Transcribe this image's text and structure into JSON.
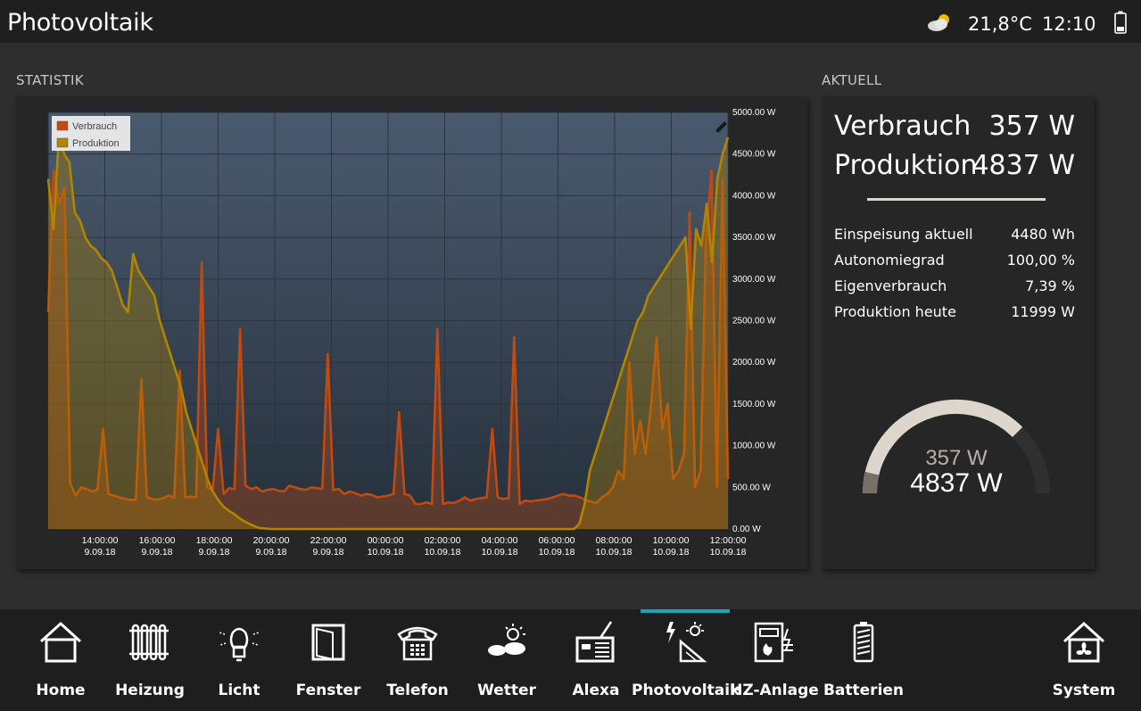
{
  "header": {
    "title": "Photovoltaik",
    "weather_icon": "partly-cloudy-icon",
    "temperature": "21,8°C",
    "time": "12:10",
    "battery_icon": "battery-icon"
  },
  "statistik": {
    "section_title": "STATISTIK",
    "chart_data": {
      "type": "line",
      "title": "",
      "series": [
        {
          "name": "Verbrauch",
          "color": "#c04a10",
          "values": [
            2600,
            4300,
            3900,
            4100,
            550,
            400,
            500,
            480,
            450,
            470,
            1200,
            420,
            400,
            380,
            360,
            350,
            350,
            1800,
            380,
            360,
            350,
            370,
            400,
            380,
            1900,
            380,
            390,
            380,
            3200,
            500,
            460,
            1200,
            420,
            490,
            480,
            2400,
            520,
            480,
            500,
            450,
            470,
            480,
            460,
            450,
            520,
            500,
            480,
            470,
            500,
            490,
            480,
            2100,
            470,
            480,
            420,
            450,
            430,
            400,
            420,
            410,
            380,
            390,
            400,
            420,
            1400,
            420,
            400,
            300,
            300,
            320,
            300,
            2400,
            300,
            320,
            310,
            340,
            380,
            340,
            360,
            370,
            380,
            1200,
            380,
            360,
            370,
            2300,
            300,
            340,
            330,
            340,
            350,
            360,
            380,
            400,
            420,
            400,
            400,
            380,
            350,
            330,
            310,
            380,
            420,
            500,
            700,
            600,
            2000,
            900,
            1300,
            900,
            1500,
            2300,
            1200,
            1500,
            600,
            700,
            900,
            3800,
            500,
            700,
            3500,
            4300,
            500,
            4200,
            600
          ]
        },
        {
          "name": "Produktion",
          "color": "#b08500",
          "values": [
            4200,
            3600,
            4700,
            4500,
            4400,
            3800,
            3700,
            3500,
            3400,
            3350,
            3250,
            3200,
            3100,
            2900,
            2700,
            2600,
            3300,
            3100,
            3000,
            2900,
            2800,
            2500,
            2300,
            2100,
            1900,
            1700,
            1400,
            1200,
            1000,
            800,
            600,
            450,
            350,
            270,
            220,
            180,
            130,
            90,
            60,
            30,
            10,
            5,
            0,
            0,
            0,
            0,
            0,
            0,
            0,
            0,
            0,
            0,
            0,
            0,
            0,
            0,
            0,
            0,
            0,
            0,
            0,
            0,
            0,
            0,
            0,
            0,
            0,
            0,
            0,
            0,
            0,
            0,
            0,
            0,
            0,
            0,
            0,
            0,
            0,
            0,
            0,
            0,
            0,
            0,
            0,
            0,
            0,
            0,
            0,
            0,
            0,
            0,
            0,
            0,
            0,
            0,
            0,
            0,
            0,
            0,
            60,
            300,
            700,
            900,
            1100,
            1300,
            1500,
            1700,
            1900,
            2100,
            2300,
            2500,
            2600,
            2800,
            2900,
            3000,
            3100,
            3200,
            3300,
            3400,
            3500,
            2400,
            3600,
            3400,
            3900,
            3200,
            4200,
            4500,
            4700
          ]
        }
      ],
      "x_labels": [
        {
          "time": "14:00:00",
          "date": "9.09.18"
        },
        {
          "time": "16:00:00",
          "date": "9.09.18"
        },
        {
          "time": "18:00:00",
          "date": "9.09.18"
        },
        {
          "time": "20:00:00",
          "date": "9.09.18"
        },
        {
          "time": "22:00:00",
          "date": "9.09.18"
        },
        {
          "time": "00:00:00",
          "date": "10.09.18"
        },
        {
          "time": "02:00:00",
          "date": "10.09.18"
        },
        {
          "time": "04:00:00",
          "date": "10.09.18"
        },
        {
          "time": "06:00:00",
          "date": "10.09.18"
        },
        {
          "time": "08:00:00",
          "date": "10.09.18"
        },
        {
          "time": "10:00:00",
          "date": "10.09.18"
        },
        {
          "time": "12:00:00",
          "date": "10.09.18"
        }
      ],
      "y_ticks": [
        "0.00 W",
        "500.00 W",
        "1000.00 W",
        "1500.00 W",
        "2000.00 W",
        "2500.00 W",
        "3000.00 W",
        "3500.00 W",
        "4000.00 W",
        "4500.00 W",
        "5000.00 W"
      ],
      "ylim": [
        0,
        5000
      ],
      "grid": true,
      "legend_position": "top-left",
      "plot_bg": "#3e4e62"
    }
  },
  "aktuell": {
    "section_title": "AKTUELL",
    "verbrauch_label": "Verbrauch",
    "verbrauch_value": "357 W",
    "produktion_label": "Produktion",
    "produktion_value": "4837 W",
    "rows": [
      {
        "label": "Einspeisung aktuell",
        "value": "4480 Wh"
      },
      {
        "label": "Autonomiegrad",
        "value": "100,00 %"
      },
      {
        "label": "Eigenverbrauch",
        "value": "7,39 %"
      },
      {
        "label": "Produktion heute",
        "value": "11999 W"
      }
    ],
    "gauge": {
      "top_text": "357 W",
      "bottom_text": "4837 W",
      "fraction_consumption": 0.074,
      "color_track": "#ddd6cc",
      "color_fill": "#7a6f66"
    }
  },
  "nav": {
    "items": [
      {
        "label": "Home",
        "icon": "home-icon"
      },
      {
        "label": "Heizung",
        "icon": "radiator-icon"
      },
      {
        "label": "Licht",
        "icon": "light-bulb-icon"
      },
      {
        "label": "Fenster",
        "icon": "window-icon"
      },
      {
        "label": "Telefon",
        "icon": "telephone-icon"
      },
      {
        "label": "Wetter",
        "icon": "weather-icon"
      },
      {
        "label": "Alexa",
        "icon": "radio-icon"
      },
      {
        "label": "Photovoltaik",
        "icon": "solar-panel-icon"
      },
      {
        "label": "HZ-Anlage",
        "icon": "heating-system-icon"
      },
      {
        "label": "Batterien",
        "icon": "battery-icon"
      },
      {
        "label": "System",
        "icon": "system-house-icon"
      }
    ],
    "active": "Photovoltaik",
    "accent": "#1aa3b5"
  }
}
